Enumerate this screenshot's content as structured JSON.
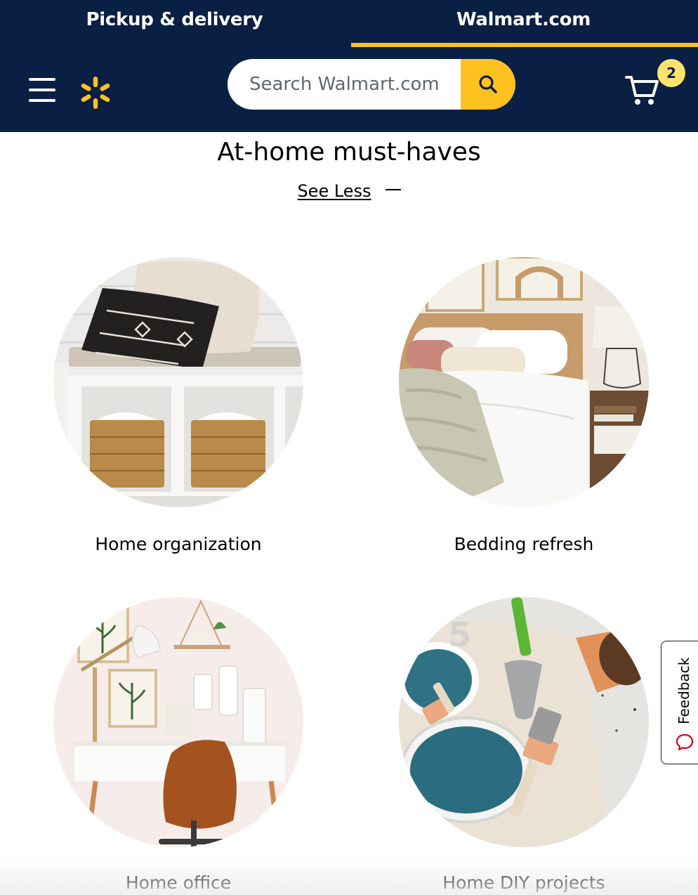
{
  "header": {
    "tabs": [
      {
        "label": "Pickup & delivery",
        "active": false
      },
      {
        "label": "Walmart.com",
        "active": true
      }
    ],
    "search": {
      "placeholder": "Search Walmart.com",
      "value": ""
    },
    "cart": {
      "count": "2"
    },
    "icons": [
      "menu-icon",
      "walmart-spark-logo",
      "search-icon",
      "cart-icon"
    ]
  },
  "section": {
    "title": "At-home must-haves",
    "toggle_label": "See Less"
  },
  "categories": [
    {
      "label": "Home organization"
    },
    {
      "label": "Bedding refresh"
    },
    {
      "label": "Home office"
    },
    {
      "label": "Home DIY projects"
    }
  ],
  "feedback": {
    "label": "Feedback"
  },
  "colors": {
    "header_bg": "#0a1f44",
    "accent": "#ffc220",
    "badge": "#ffe36b",
    "text": "#000000"
  }
}
